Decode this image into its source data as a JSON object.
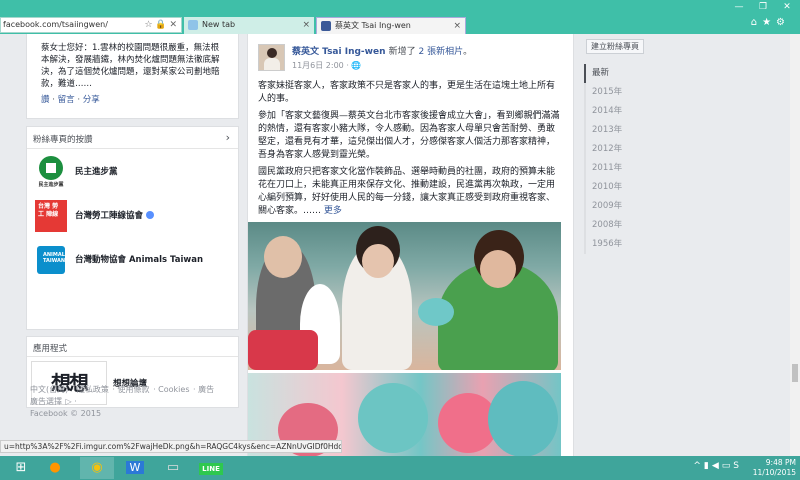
{
  "browser": {
    "address": "facebook.com/tsaiingwen/",
    "tabs": [
      {
        "label": "New tab",
        "active": false
      },
      {
        "label": "蔡英文 Tsai Ing-wen",
        "active": true
      }
    ],
    "status_url": "u=http%3A%2F%2Fi.imgur.com%2FwajHeDk.png&h=RAQGC4kys&enc=AZNnUvGIDf0HdqIPS..."
  },
  "about": {
    "text": "蔡女士您好：1.雲林的校園問題很嚴重，無法根本解決，發展牆鐵，林內焚化爐問題無法徹底解決，為了這個焚化爐問題，還對某家公司劃地賠款，難道……",
    "links": [
      "讚",
      "留言",
      "分享"
    ]
  },
  "likes": {
    "title": "粉絲專頁的按讚",
    "items": [
      {
        "name": "民主進步黨",
        "logo_text": "民主進步黨",
        "verified": false
      },
      {
        "name": "台灣勞工陣線協會",
        "logo_text": "台灣 勞工 陣線",
        "verified": true
      },
      {
        "name": "台灣動物協會 Animals Taiwan",
        "logo_text": "ANIMALS TAIWAN",
        "verified": false
      }
    ]
  },
  "apps": {
    "title": "應用程式",
    "items": [
      {
        "name": "想想論壇",
        "thumb_text": "想想"
      }
    ]
  },
  "footer": {
    "links": [
      "中文(台灣)",
      "隱私政策",
      "使用條款",
      "Cookies",
      "廣告",
      "廣告選擇"
    ],
    "copyright": "Facebook © 2015"
  },
  "post": {
    "author": "蔡英文 Tsai Ing-wen",
    "action_prefix": "新增了",
    "action_link": "2 張新相片",
    "action_suffix": "。",
    "time": "11月6日 2:00 ·",
    "paragraphs": [
      "客家妹挺客家人，客家政策不只是客家人的事，更是生活在這塊土地上所有人的事。",
      "參加「客家文藝復興—蔡英文台北市客家後援會成立大會」，看到鄉親們滿滿的熱情，還有客家小豬大隊，令人感動。因為客家人母單只會苦耐勞、勇敢堅定，還看見有才華，這兒傑出個人才，分感傑客家人個活力那客家精神，吾身為客家人感覺到靈光榮。",
      "國民黨政府只把客家文化當作裝飾品、選舉時動員的社團，政府的預算未能花在刀口上，未能真正用來保存文化、推動建設，民進黨再次執政，一定用心編列預算，好好使用人民的每一分錢，讓大家真正感受到政府重視客家、關心客家。……"
    ],
    "more_label": "更多"
  },
  "right": {
    "build_button": "建立粉絲專頁",
    "years": [
      "最新",
      "2015年",
      "2014年",
      "2013年",
      "2012年",
      "2011年",
      "2010年",
      "2009年",
      "2008年",
      "1956年"
    ]
  },
  "taskbar": {
    "time": "9:48 PM",
    "date": "11/10/2015",
    "apps": [
      {
        "name": "firefox",
        "glyph": "●",
        "color": "#ff9500"
      },
      {
        "name": "chrome",
        "glyph": "◉",
        "color": "#f4c20d"
      },
      {
        "name": "word",
        "glyph": "W",
        "color": "#2b79d6"
      },
      {
        "name": "explorer",
        "glyph": "▭",
        "color": "#ddd"
      },
      {
        "name": "line",
        "glyph": "LINE",
        "color": "#2ec84e"
      }
    ]
  }
}
